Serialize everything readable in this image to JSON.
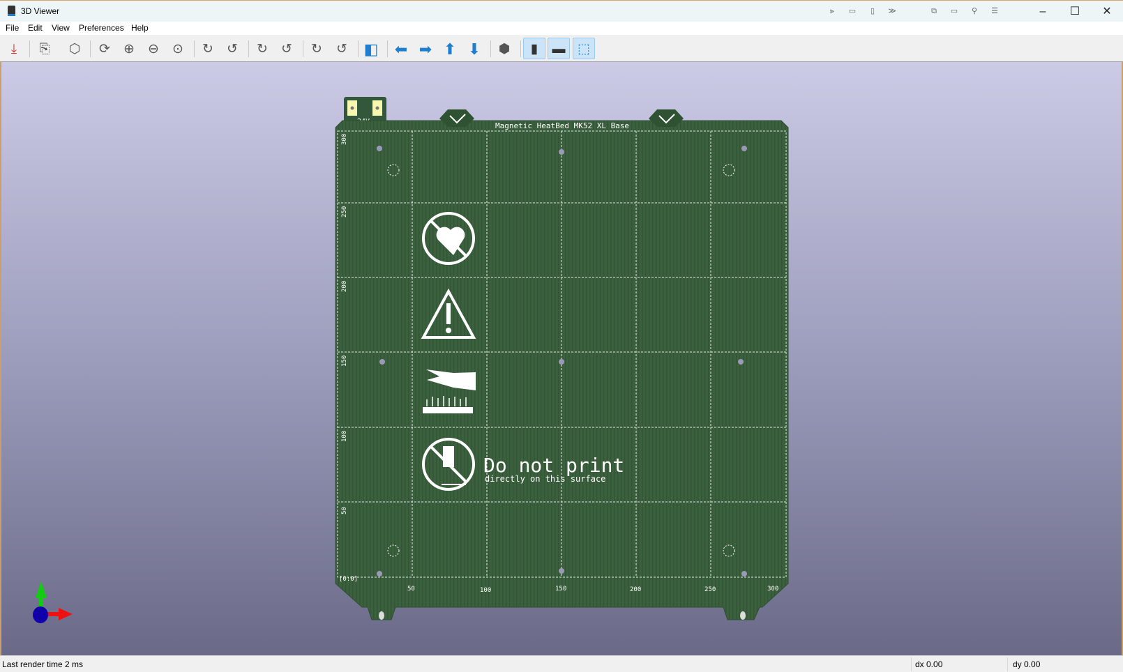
{
  "window": {
    "title": "3D Viewer",
    "controls": [
      "minimize",
      "maximize",
      "close"
    ]
  },
  "menu": [
    "File",
    "Edit",
    "View",
    "Preferences",
    "Help"
  ],
  "toolbar": [
    {
      "name": "export-current-view-icon"
    },
    {
      "name": "copy-3d-image-icon"
    },
    {
      "name": "raytracing-icon"
    },
    {
      "name": "reload-board-icon"
    },
    {
      "name": "zoom-in-icon"
    },
    {
      "name": "zoom-out-icon"
    },
    {
      "name": "zoom-fit-icon"
    },
    {
      "name": "rotate-x-clockwise-icon"
    },
    {
      "name": "rotate-x-counterclockwise-icon"
    },
    {
      "name": "rotate-y-clockwise-icon"
    },
    {
      "name": "rotate-y-counterclockwise-icon"
    },
    {
      "name": "rotate-z-clockwise-icon"
    },
    {
      "name": "rotate-z-counterclockwise-icon"
    },
    {
      "name": "flip-board-icon"
    },
    {
      "name": "move-left-icon"
    },
    {
      "name": "move-right-icon"
    },
    {
      "name": "move-up-icon"
    },
    {
      "name": "move-down-icon"
    },
    {
      "name": "toggle-orthographic-icon"
    },
    {
      "name": "show-tht-models-icon",
      "active": true
    },
    {
      "name": "show-smd-models-icon",
      "active": true
    },
    {
      "name": "show-virtual-models-icon",
      "active": true
    }
  ],
  "board": {
    "title": "Magnetic HeatBed MK52 XL Base",
    "voltage": "24V",
    "origin": "[0:0]",
    "x_ticks": [
      "50",
      "100",
      "150",
      "200",
      "250",
      "300"
    ],
    "y_ticks": [
      "300",
      "250",
      "200",
      "150",
      "100",
      "50"
    ],
    "notice_title": "Do not print",
    "notice_sub": "directly on this surface",
    "colors": {
      "board": "#3a5f3c",
      "silk": "#ffffff",
      "pad": "#f7f7b0",
      "hole": "#9a9ab8"
    }
  },
  "status": {
    "render": "Last render time 2 ms",
    "dx": "dx 0.00",
    "dy": "dy 0.00"
  }
}
